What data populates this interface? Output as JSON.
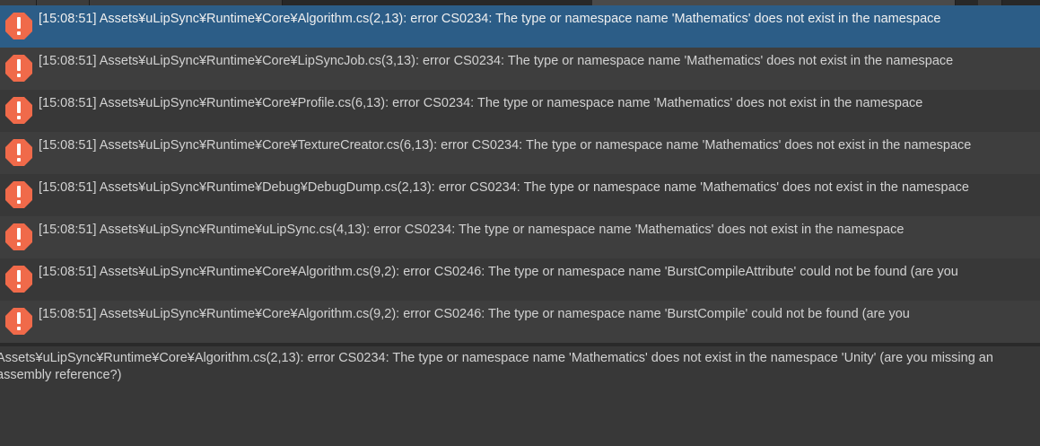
{
  "colors": {
    "background": "#383838",
    "selected_row": "#2c5d87",
    "error_icon": "#f06a4a",
    "text": "#d2d2d2"
  },
  "log_entries": [
    {
      "icon": "error-icon",
      "text": "[15:08:51] Assets¥uLipSync¥Runtime¥Core¥Algorithm.cs(2,13): error CS0234: The type or namespace name 'Mathematics' does not exist in the namespace"
    },
    {
      "icon": "error-icon",
      "text": "[15:08:51] Assets¥uLipSync¥Runtime¥Core¥LipSyncJob.cs(3,13): error CS0234: The type or namespace name 'Mathematics' does not exist in the namespace"
    },
    {
      "icon": "error-icon",
      "text": "[15:08:51] Assets¥uLipSync¥Runtime¥Core¥Profile.cs(6,13): error CS0234: The type or namespace name 'Mathematics' does not exist in the namespace"
    },
    {
      "icon": "error-icon",
      "text": "[15:08:51] Assets¥uLipSync¥Runtime¥Core¥TextureCreator.cs(6,13): error CS0234: The type or namespace name 'Mathematics' does not exist in the namespace"
    },
    {
      "icon": "error-icon",
      "text": "[15:08:51] Assets¥uLipSync¥Runtime¥Debug¥DebugDump.cs(2,13): error CS0234: The type or namespace name 'Mathematics' does not exist in the namespace"
    },
    {
      "icon": "error-icon",
      "text": "[15:08:51] Assets¥uLipSync¥Runtime¥uLipSync.cs(4,13): error CS0234: The type or namespace name 'Mathematics' does not exist in the namespace"
    },
    {
      "icon": "error-icon",
      "text": "[15:08:51] Assets¥uLipSync¥Runtime¥Core¥Algorithm.cs(9,2): error CS0246: The type or namespace name 'BurstCompileAttribute' could not be found (are you"
    },
    {
      "icon": "error-icon",
      "text": "[15:08:51] Assets¥uLipSync¥Runtime¥Core¥Algorithm.cs(9,2): error CS0246: The type or namespace name 'BurstCompile' could not be found (are you"
    }
  ],
  "detail": {
    "text": "Assets¥uLipSync¥Runtime¥Core¥Algorithm.cs(2,13): error CS0234: The type or namespace name 'Mathematics' does not exist in the namespace 'Unity' (are you missing an assembly reference?)"
  }
}
